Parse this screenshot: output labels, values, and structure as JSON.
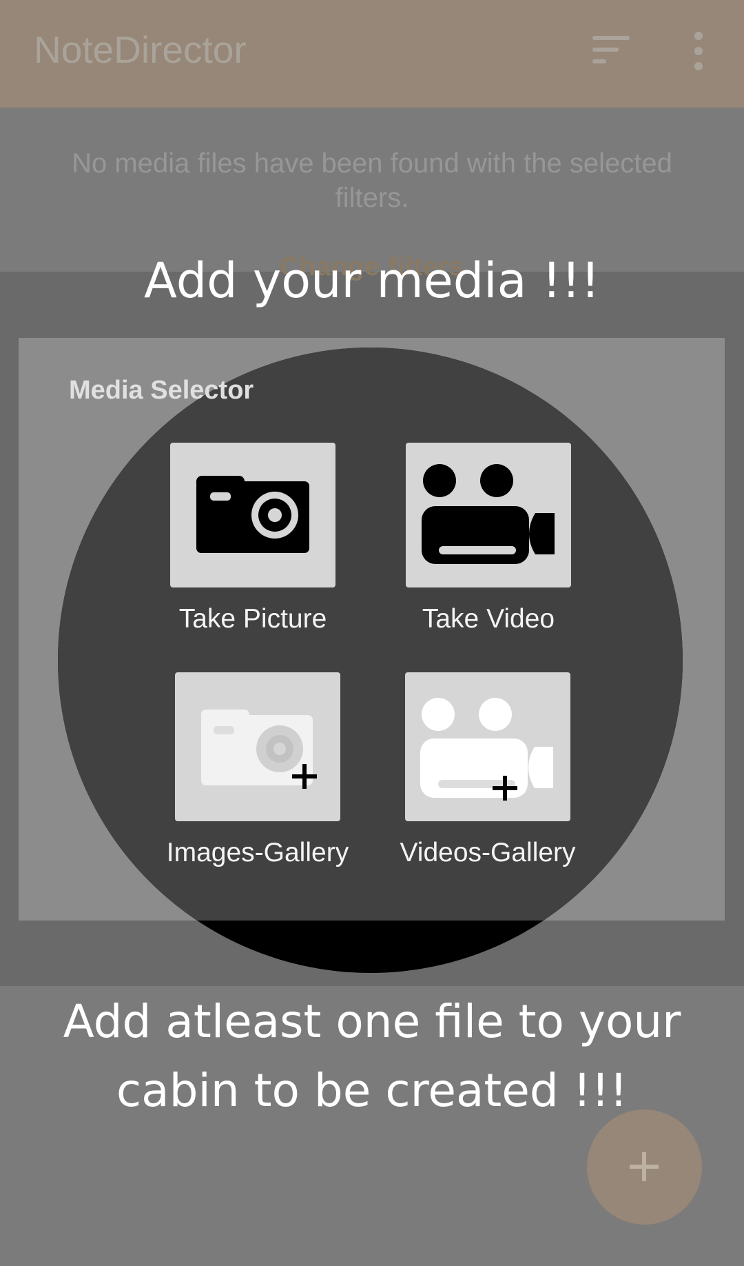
{
  "app": {
    "title": "NoteDirector",
    "sort_icon": "sort-icon",
    "more_icon": "more-vert-icon"
  },
  "empty_state": {
    "message": "No media files have been found with the selected filters.",
    "change_filters": "Change filters"
  },
  "tour": {
    "title": "Add your media !!!",
    "description": "Add atleast one file to your cabin to be created !!!"
  },
  "media_selector": {
    "title": "Media Selector",
    "options": [
      {
        "label": "Take Picture",
        "icon": "camera-icon"
      },
      {
        "label": "Take Video",
        "icon": "video-camera-icon"
      },
      {
        "label": "Images-Gallery",
        "icon": "camera-add-icon"
      },
      {
        "label": "Videos-Gallery",
        "icon": "video-camera-add-icon"
      }
    ]
  },
  "fab": {
    "icon": "plus-icon"
  },
  "colors": {
    "appbar": "#978778",
    "scrim": "#7b7b7b",
    "dialog": "#8c8c8c",
    "spotlight": "#414141",
    "tile": "#d6d6d6"
  }
}
